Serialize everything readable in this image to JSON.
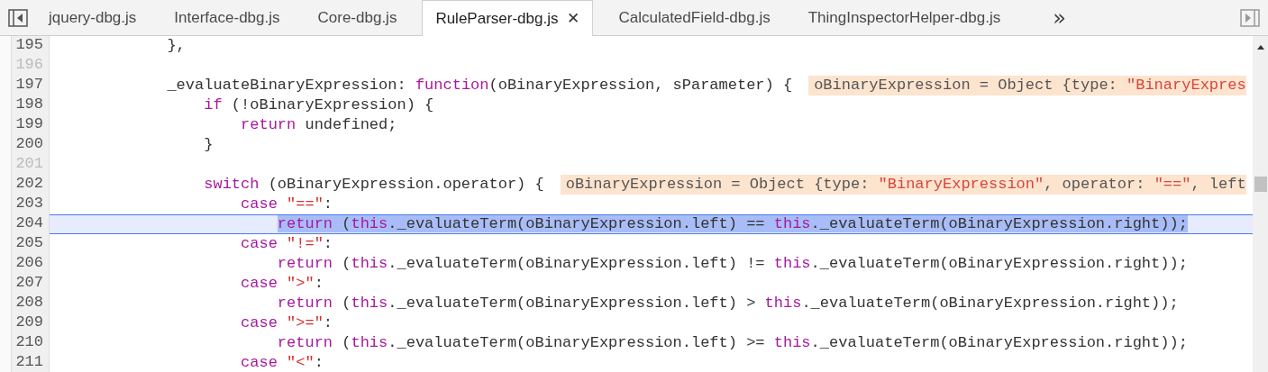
{
  "tabs": [
    {
      "label": "jquery-dbg.js",
      "selected": false
    },
    {
      "label": "Interface-dbg.js",
      "selected": false
    },
    {
      "label": "Core-dbg.js",
      "selected": false
    },
    {
      "label": "RuleParser-dbg.js",
      "selected": true,
      "close": "✕"
    },
    {
      "label": "CalculatedField-dbg.js",
      "selected": false
    },
    {
      "label": "ThingInspectorHelper-dbg.js",
      "selected": false
    }
  ],
  "overflow": "»",
  "lines": [
    {
      "number": "195",
      "highlighted": false,
      "tokens": [
        {
          "text": "            },",
          "kind": "plain"
        }
      ]
    },
    {
      "number": "196",
      "highlighted": false
    },
    {
      "number": "197",
      "highlighted": false,
      "tokens": [
        {
          "text": "            _evaluateBinaryExpression: ",
          "kind": "plain"
        },
        {
          "text": "function",
          "kind": "keyword"
        },
        {
          "text": "(oBinaryExpression, sParameter) {",
          "kind": "plain"
        }
      ],
      "inline_value": [
        {
          "text": "oBinaryExpression = Object {type: ",
          "kind": "plain"
        },
        {
          "text": "\"BinaryExpres",
          "kind": "string"
        }
      ]
    },
    {
      "number": "198",
      "highlighted": false,
      "tokens": [
        {
          "text": "                if",
          "kind": "keyword"
        },
        {
          "text": " (!oBinaryExpression) {",
          "kind": "plain"
        }
      ]
    },
    {
      "number": "199",
      "highlighted": false,
      "tokens": [
        {
          "text": "                    return",
          "kind": "keyword"
        },
        {
          "text": " undefined;",
          "kind": "plain"
        }
      ]
    },
    {
      "number": "200",
      "highlighted": false,
      "tokens": [
        {
          "text": "                }",
          "kind": "plain"
        }
      ]
    },
    {
      "number": "201",
      "highlighted": false
    },
    {
      "number": "202",
      "highlighted": false,
      "tokens": [
        {
          "text": "                switch",
          "kind": "keyword"
        },
        {
          "text": " (oBinaryExpression.operator) {",
          "kind": "plain"
        }
      ],
      "inline_value": [
        {
          "text": "oBinaryExpression = Object {type: ",
          "kind": "plain"
        },
        {
          "text": "\"BinaryExpression\"",
          "kind": "string"
        },
        {
          "text": ", operator: ",
          "kind": "plain"
        },
        {
          "text": "\"==\"",
          "kind": "string"
        },
        {
          "text": ", left",
          "kind": "plain"
        }
      ]
    },
    {
      "number": "203",
      "highlighted": false,
      "tokens": [
        {
          "text": "                    case",
          "kind": "keyword"
        },
        {
          "text": " \"==\"",
          "kind": "string"
        },
        {
          "text": ":",
          "kind": "plain"
        }
      ]
    },
    {
      "number": "204",
      "highlighted": true,
      "tokens": [
        {
          "text": "                        return",
          "kind": "keyword"
        },
        {
          "text": " (",
          "kind": "plain"
        },
        {
          "text": "this",
          "kind": "keyword"
        },
        {
          "text": "._evaluateTerm(oBinaryExpression.left) == ",
          "kind": "plain"
        },
        {
          "text": "this",
          "kind": "keyword"
        },
        {
          "text": "._evaluateTerm(oBinaryExpression.right));",
          "kind": "plain"
        }
      ]
    },
    {
      "number": "205",
      "highlighted": false,
      "tokens": [
        {
          "text": "                    case",
          "kind": "keyword"
        },
        {
          "text": " \"!=\"",
          "kind": "string"
        },
        {
          "text": ":",
          "kind": "plain"
        }
      ]
    },
    {
      "number": "206",
      "highlighted": false,
      "tokens": [
        {
          "text": "                        return",
          "kind": "keyword"
        },
        {
          "text": " (",
          "kind": "plain"
        },
        {
          "text": "this",
          "kind": "keyword"
        },
        {
          "text": "._evaluateTerm(oBinaryExpression.left) != ",
          "kind": "plain"
        },
        {
          "text": "this",
          "kind": "keyword"
        },
        {
          "text": "._evaluateTerm(oBinaryExpression.right));",
          "kind": "plain"
        }
      ]
    },
    {
      "number": "207",
      "highlighted": false,
      "tokens": [
        {
          "text": "                    case",
          "kind": "keyword"
        },
        {
          "text": " \">\"",
          "kind": "string"
        },
        {
          "text": ":",
          "kind": "plain"
        }
      ]
    },
    {
      "number": "208",
      "highlighted": false,
      "tokens": [
        {
          "text": "                        return",
          "kind": "keyword"
        },
        {
          "text": " (",
          "kind": "plain"
        },
        {
          "text": "this",
          "kind": "keyword"
        },
        {
          "text": "._evaluateTerm(oBinaryExpression.left) > ",
          "kind": "plain"
        },
        {
          "text": "this",
          "kind": "keyword"
        },
        {
          "text": "._evaluateTerm(oBinaryExpression.right));",
          "kind": "plain"
        }
      ]
    },
    {
      "number": "209",
      "highlighted": false,
      "tokens": [
        {
          "text": "                    case",
          "kind": "keyword"
        },
        {
          "text": " \">=\"",
          "kind": "string"
        },
        {
          "text": ":",
          "kind": "plain"
        }
      ]
    },
    {
      "number": "210",
      "highlighted": false,
      "tokens": [
        {
          "text": "                        return",
          "kind": "keyword"
        },
        {
          "text": " (",
          "kind": "plain"
        },
        {
          "text": "this",
          "kind": "keyword"
        },
        {
          "text": "._evaluateTerm(oBinaryExpression.left) >= ",
          "kind": "plain"
        },
        {
          "text": "this",
          "kind": "keyword"
        },
        {
          "text": "._evaluateTerm(oBinaryExpression.right));",
          "kind": "plain"
        }
      ]
    },
    {
      "number": "211",
      "highlighted": false,
      "tokens": [
        {
          "text": "                    case",
          "kind": "keyword"
        },
        {
          "text": " \"<\"",
          "kind": "string"
        },
        {
          "text": ":",
          "kind": "plain"
        }
      ]
    }
  ]
}
